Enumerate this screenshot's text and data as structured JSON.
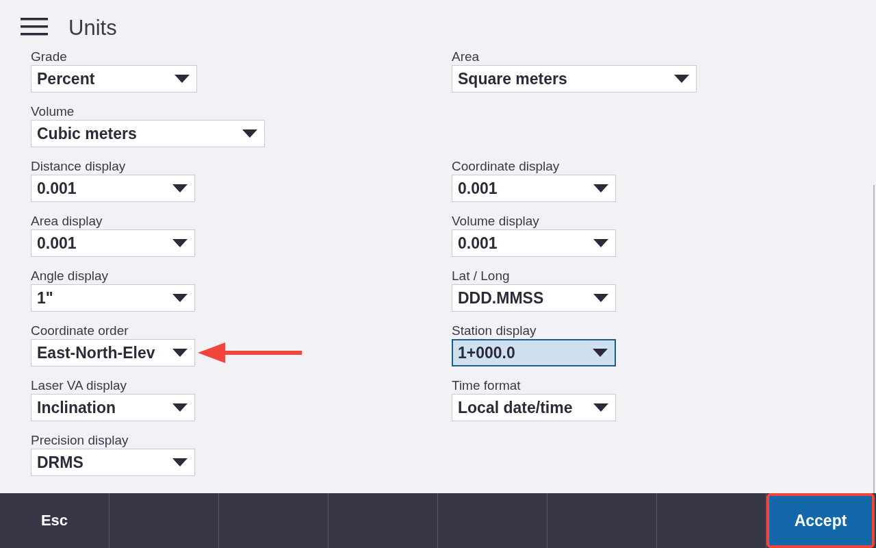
{
  "header": {
    "title": "Units"
  },
  "rows": [
    {
      "left": {
        "label": "Grade",
        "value": "Percent",
        "focused": false,
        "pointed": false
      },
      "right": {
        "label": "Area",
        "value": "Square meters",
        "focused": false,
        "pointed": false
      }
    },
    {
      "left": {
        "label": "Volume",
        "value": "Cubic meters",
        "focused": false,
        "pointed": false
      }
    },
    {
      "left": {
        "label": "Distance display",
        "value": "0.001",
        "focused": false,
        "pointed": false
      },
      "right": {
        "label": "Coordinate display",
        "value": "0.001",
        "focused": false,
        "pointed": false
      }
    },
    {
      "left": {
        "label": "Area display",
        "value": "0.001",
        "focused": false,
        "pointed": false
      },
      "right": {
        "label": "Volume display",
        "value": "0.001",
        "focused": false,
        "pointed": false
      }
    },
    {
      "left": {
        "label": "Angle display",
        "value": "1\"",
        "focused": false,
        "pointed": false
      },
      "right": {
        "label": "Lat / Long",
        "value": "DDD.MMSS",
        "focused": false,
        "pointed": false
      }
    },
    {
      "left": {
        "label": "Coordinate order",
        "value": "East-North-Elev",
        "focused": false,
        "pointed": true
      },
      "right": {
        "label": "Station display",
        "value": "1+000.0",
        "focused": true,
        "pointed": false
      }
    },
    {
      "left": {
        "label": "Laser VA display",
        "value": "Inclination",
        "focused": false,
        "pointed": false
      },
      "right": {
        "label": "Time format",
        "value": "Local date/time",
        "focused": false,
        "pointed": false
      }
    },
    {
      "left": {
        "label": "Precision display",
        "value": "DRMS",
        "focused": false,
        "pointed": false
      }
    }
  ],
  "bottom_bar": {
    "left_key": "Esc",
    "right_key": {
      "label": "Accept",
      "highlighted": true
    }
  }
}
